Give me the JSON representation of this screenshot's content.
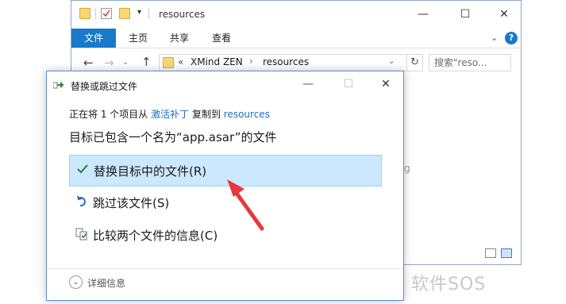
{
  "explorer": {
    "title": "resources",
    "ribbon_tabs": [
      {
        "label": "文件",
        "active": true
      },
      {
        "label": "主页"
      },
      {
        "label": "共享"
      },
      {
        "label": "查看"
      }
    ],
    "breadcrumb": {
      "chevron": "«",
      "segments": [
        "XMind ZEN",
        "resources"
      ]
    },
    "search_placeholder": "搜索\"reso...",
    "partial_bg_text": "g"
  },
  "dialog": {
    "title": "替换或跳过文件",
    "progress": {
      "prefix": "正在将 1 个项目从",
      "source": "激活补丁",
      "middle": "复制到",
      "dest": "resources"
    },
    "heading": "目标已包含一个名为“app.asar”的文件",
    "options": [
      {
        "label": "替换目标中的文件(R)",
        "icon": "check-icon",
        "highlighted": true
      },
      {
        "label": "跳过该文件(S)",
        "icon": "skip-icon"
      },
      {
        "label": "比较两个文件的信息(C)",
        "icon": "compare-icon"
      }
    ],
    "details_label": "详细信息"
  },
  "watermark": "软件SOS",
  "colors": {
    "accent": "#1979ca",
    "highlight": "#cce8ff",
    "arrow": "#e8383a",
    "link": "#1f6dbf"
  }
}
